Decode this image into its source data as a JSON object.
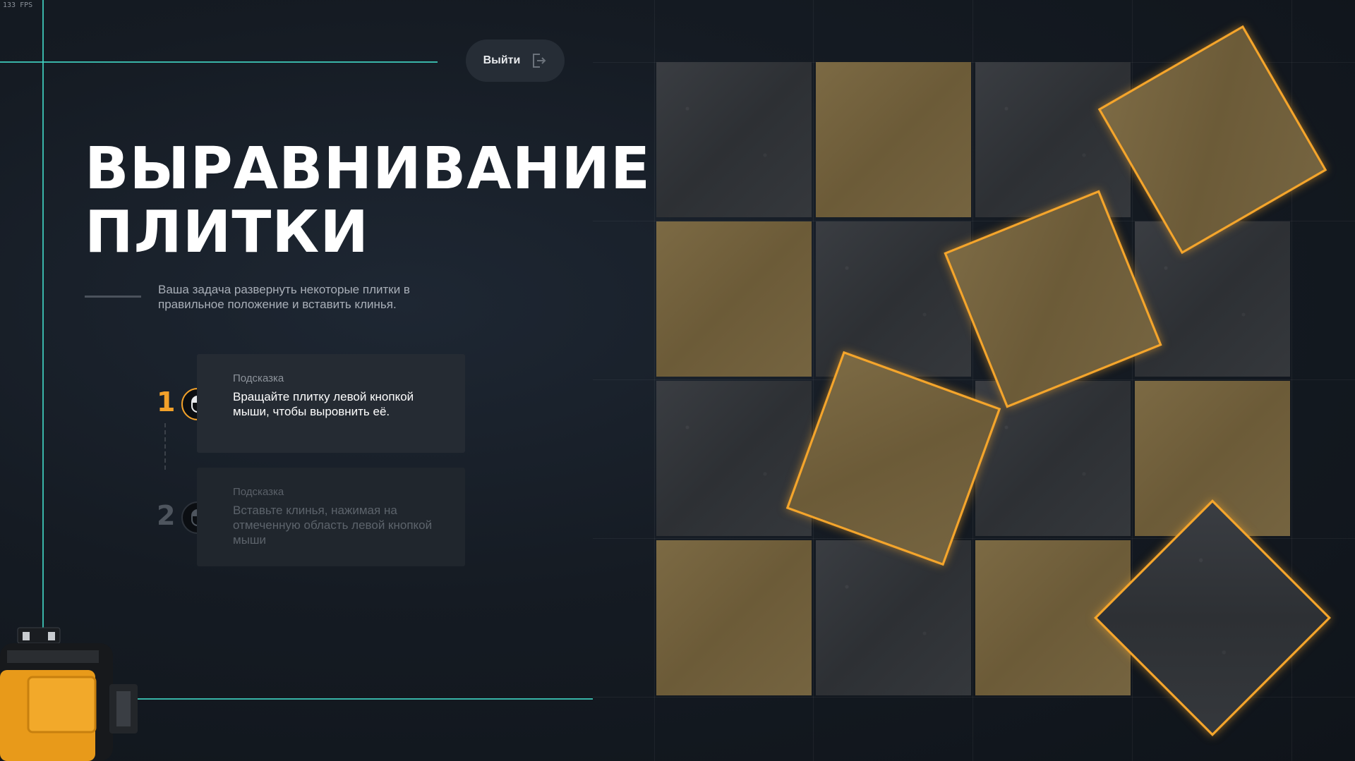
{
  "hud": {
    "fps": "133 FPS"
  },
  "header": {
    "exit_label": "Выйти",
    "exit_icon": "exit-icon"
  },
  "title": {
    "line1": "ВЫРАВНИВАНИЕ",
    "line2": "ПЛИТКИ"
  },
  "description": "Ваша задача развернуть некоторые плитки в правильное положение и вставить клинья.",
  "hints": [
    {
      "number": "1",
      "label": "Подсказка",
      "text": "Вращайте плитку левой кнопкой мыши, чтобы выровнить её.",
      "icon": "mouse-icon",
      "state": "active"
    },
    {
      "number": "2",
      "label": "Подсказка",
      "text": "Вставьте клинья, нажимая на отмеченную область левой кнопкой мыши",
      "icon": "mouse-icon",
      "state": "inactive"
    }
  ],
  "board": {
    "rows": 4,
    "cols": 4,
    "tiles": [
      {
        "row": 0,
        "col": 0,
        "color": "dark",
        "rotation": 0
      },
      {
        "row": 0,
        "col": 1,
        "color": "tan",
        "rotation": 0
      },
      {
        "row": 0,
        "col": 2,
        "color": "dark",
        "rotation": 0
      },
      {
        "row": 0,
        "col": 3,
        "color": "tan",
        "rotation": -30
      },
      {
        "row": 1,
        "col": 0,
        "color": "tan",
        "rotation": 0
      },
      {
        "row": 1,
        "col": 1,
        "color": "dark",
        "rotation": 0
      },
      {
        "row": 1,
        "col": 2,
        "color": "tan",
        "rotation": -22
      },
      {
        "row": 1,
        "col": 3,
        "color": "dark",
        "rotation": 0
      },
      {
        "row": 2,
        "col": 0,
        "color": "dark",
        "rotation": 0
      },
      {
        "row": 2,
        "col": 1,
        "color": "tan",
        "rotation": 20
      },
      {
        "row": 2,
        "col": 2,
        "color": "dark",
        "rotation": 0
      },
      {
        "row": 2,
        "col": 3,
        "color": "tan",
        "rotation": 0
      },
      {
        "row": 3,
        "col": 0,
        "color": "tan",
        "rotation": 0
      },
      {
        "row": 3,
        "col": 1,
        "color": "dark",
        "rotation": 0
      },
      {
        "row": 3,
        "col": 2,
        "color": "tan",
        "rotation": 0
      },
      {
        "row": 3,
        "col": 3,
        "color": "dark",
        "rotation": 45
      }
    ]
  },
  "colors": {
    "accent": "#f4a52c",
    "guide": "#3fd0c0",
    "tile_dark": "#33363a",
    "tile_tan": "#74623e"
  }
}
